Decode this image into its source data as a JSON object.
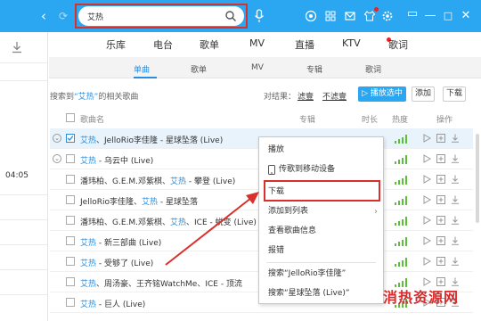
{
  "search": {
    "value": "艾热"
  },
  "main_tabs": [
    "乐库",
    "电台",
    "歌单",
    "MV",
    "直播",
    "KTV",
    "歌词"
  ],
  "sub_tabs": [
    "单曲",
    "歌单",
    "MV",
    "专辑",
    "歌词"
  ],
  "result_info": {
    "prefix": "搜索到",
    "keyword": "“艾热”",
    "suffix": "的相关歌曲"
  },
  "result_filter": {
    "label": "对结果：",
    "opt1": "滤壹",
    "opt2": "不滤壹"
  },
  "buttons": {
    "play_selected": "播放选中",
    "add": "添加",
    "download": "下载"
  },
  "table_headers": {
    "song": "歌曲名",
    "album": "专辑",
    "duration": "时长",
    "heat": "热度",
    "ops": "操作"
  },
  "left_panel": {
    "time": "04:05"
  },
  "rows": [
    {
      "kw": "艾热",
      "rest": "、JelloRio李佳隆 - 星球坠落 (Live)"
    },
    {
      "kw": "艾热",
      "rest": " - 乌云中 (Live)"
    },
    {
      "pre": "潘玮柏、G.E.M.邓紫棋、",
      "kw": "艾热",
      "rest": " - 攀登 (Live)"
    },
    {
      "pre": "JelloRio李佳隆、",
      "kw": "艾热",
      "rest": " - 星球坠落"
    },
    {
      "pre": "潘玮柏、G.E.M.邓紫棋、",
      "kw": "艾热",
      "rest": "、ICE - 蜕变 (Live)"
    },
    {
      "kw": "艾热",
      "rest": " - 新三部曲 (Live)"
    },
    {
      "kw": "艾热",
      "rest": " - 受够了 (Live)"
    },
    {
      "kw": "艾热",
      "rest": "、周汤豪、王齐铭WatchMe、ICE - 顶流"
    },
    {
      "kw": "艾热",
      "rest": " - 巨人 (Live)"
    }
  ],
  "context_menu": {
    "play": "播放",
    "send_mobile": "传歌到移动设备",
    "download": "下载",
    "add_to_list": "添加到列表",
    "song_info": "查看歌曲信息",
    "report": "报错",
    "search_artist": "搜索“JelloRio李佳隆”",
    "search_song": "搜索“星球坠落 (Live)”"
  },
  "watermark": "消热资源网",
  "colors": {
    "brand_blue": "#2ba6f0",
    "highlight_red": "#d9302b",
    "signal_green": "#5cbf3a"
  }
}
